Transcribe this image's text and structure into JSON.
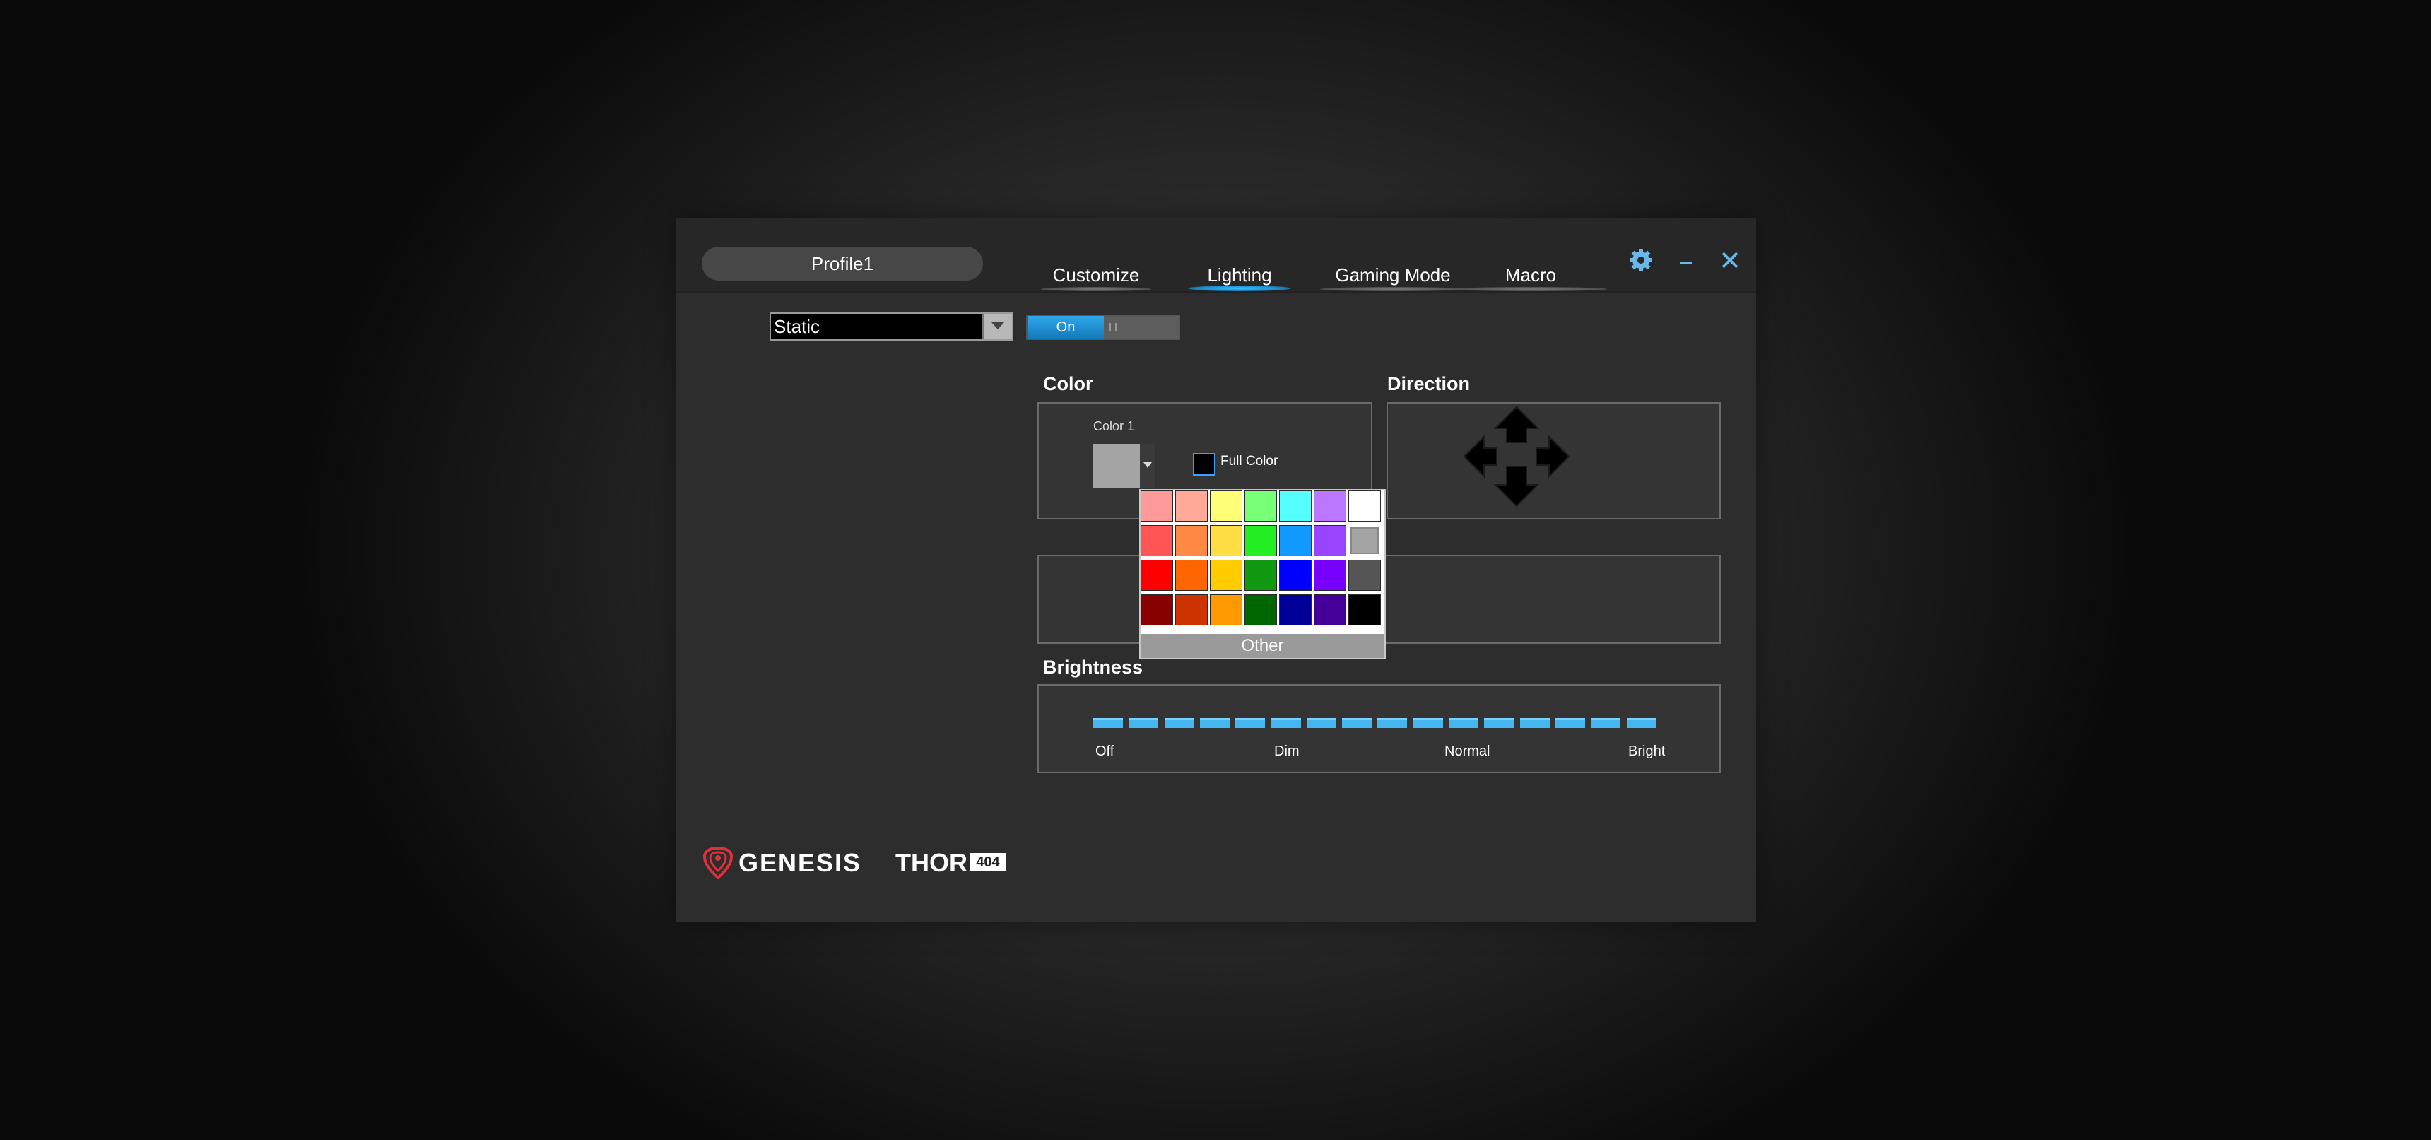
{
  "profile": {
    "name": "Profile1"
  },
  "tabs": [
    {
      "label": "Customize",
      "active": false
    },
    {
      "label": "Lighting",
      "active": true
    },
    {
      "label": "Gaming Mode",
      "active": false
    },
    {
      "label": "Macro",
      "active": false
    }
  ],
  "window_controls": {
    "settings_icon": "gear-icon",
    "minimize_icon": "minimize-icon",
    "close_icon": "close-icon"
  },
  "mode": {
    "selected": "Static"
  },
  "toggle": {
    "label": "On",
    "state": "on"
  },
  "color_section": {
    "title": "Color",
    "color1_label": "Color 1",
    "color1_value": "#a4a4a4",
    "full_color_label": "Full Color",
    "full_color_checked": false
  },
  "direction_section": {
    "title": "Direction",
    "arrows": [
      "arrow-up-icon",
      "arrow-left-icon",
      "arrow-right-icon",
      "arrow-down-icon"
    ]
  },
  "palette": {
    "rows": [
      [
        "#ff9a9a",
        "#ffaa99",
        "#ffff77",
        "#77ff77",
        "#55ffff",
        "#bb77ff",
        "#ffffff"
      ],
      [
        "#ff5555",
        "#ff8844",
        "#ffdd44",
        "#22ee22",
        "#1199ff",
        "#9944ff",
        "#a4a4a4"
      ],
      [
        "#ff0000",
        "#ff6600",
        "#ffcc00",
        "#119911",
        "#0000ff",
        "#7700ff",
        "#555555"
      ],
      [
        "#880000",
        "#cc3300",
        "#ff9900",
        "#006600",
        "#000099",
        "#440099",
        "#000000"
      ]
    ],
    "selected": "#a4a4a4",
    "other_label": "Other"
  },
  "brightness": {
    "title": "Brightness",
    "segments": 16,
    "level": 16,
    "labels": [
      "Off",
      "Dim",
      "Normal",
      "Bright"
    ]
  },
  "brand": {
    "logo_text": "GENESIS",
    "product": "THOR",
    "model": "404"
  },
  "colors": {
    "accent": "#1e9be0",
    "panel_border": "#6b6b6b",
    "window_bg": "#2d2d2d"
  }
}
